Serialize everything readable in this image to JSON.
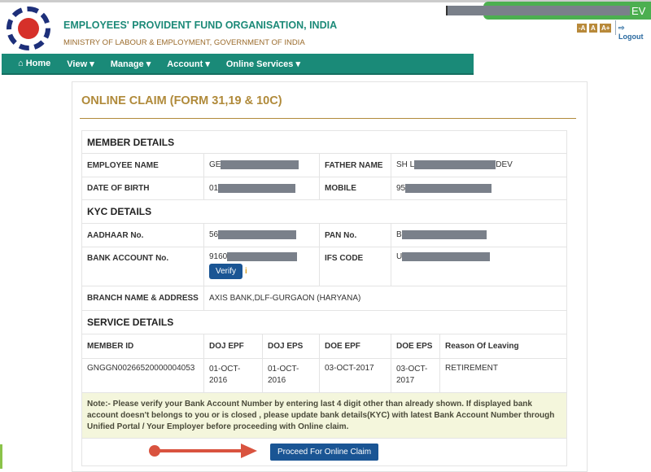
{
  "header": {
    "org_name": "EMPLOYEES' PROVIDENT FUND ORGANISATION, INDIA",
    "ministry": "MINISTRY OF LABOUR & EMPLOYMENT, GOVERNMENT OF INDIA",
    "user_suffix": "EV",
    "font_controls": [
      "-A",
      "A",
      "A+"
    ],
    "logout": "Logout"
  },
  "nav": {
    "items": [
      "Home",
      "View ▾",
      "Manage ▾",
      "Account ▾",
      "Online Services ▾"
    ]
  },
  "page": {
    "title": "ONLINE CLAIM (FORM 31,19 & 10C)"
  },
  "member": {
    "heading": "MEMBER DETAILS",
    "employee_name_label": "EMPLOYEE NAME",
    "employee_name": "GE",
    "father_name_label": "FATHER NAME",
    "father_name_prefix": "SH L",
    "father_name_suffix": "DEV",
    "dob_label": "DATE OF BIRTH",
    "dob": "01",
    "mobile_label": "MOBILE",
    "mobile": "95"
  },
  "kyc": {
    "heading": "KYC DETAILS",
    "aadhaar_label": "AADHAAR No.",
    "aadhaar": "56",
    "pan_label": "PAN No.",
    "pan": "B",
    "bank_label": "BANK ACCOUNT No.",
    "bank": "9160",
    "verify": "Verify",
    "ifs_label": "IFS CODE",
    "ifs": "U",
    "branch_label": "BRANCH NAME & ADDRESS",
    "branch": "AXIS BANK,DLF-GURGAON (HARYANA)"
  },
  "service": {
    "heading": "SERVICE DETAILS",
    "columns": [
      "MEMBER ID",
      "DOJ EPF",
      "DOJ EPS",
      "DOE EPF",
      "DOE EPS",
      "Reason Of Leaving"
    ],
    "row": [
      "GNGGN00266520000004053",
      "01-OCT-2016",
      "01-OCT-2016",
      "03-OCT-2017",
      "03-OCT-2017",
      "RETIREMENT"
    ]
  },
  "note": "Note:- Please verify your Bank Account Number by entering last 4 digit other than already shown. If displayed bank account doesn't belongs to you or is closed , please update bank details(KYC) with latest Bank Account Number through Unified Portal / Your Employer before proceeding with Online claim.",
  "proceed": "Proceed For Online Claim",
  "colors": {
    "nav": "#1a8a78",
    "title": "#b08a3a",
    "button": "#1a5594",
    "arrow": "#d9533f"
  }
}
